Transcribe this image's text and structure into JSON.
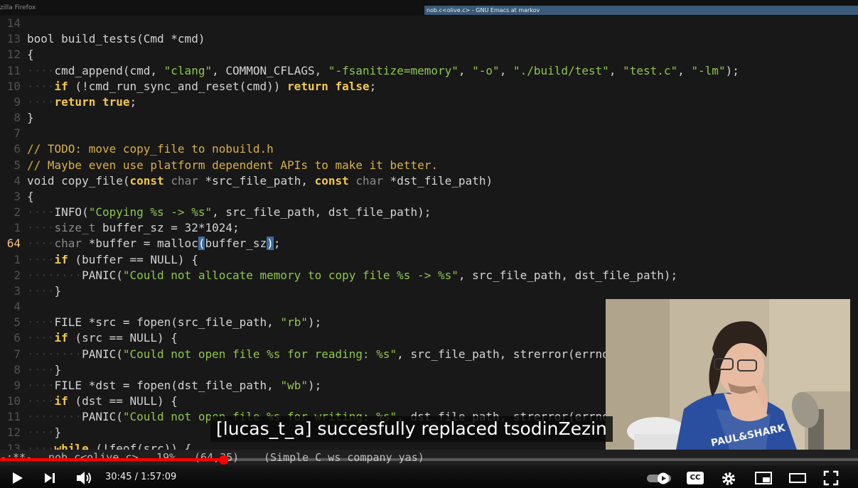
{
  "browser": {
    "title_fragment": "zilla Firefox"
  },
  "emacs": {
    "window_title": "nob.c<olive.c> - GNU Emacs at markov"
  },
  "colors": {
    "keyword": "#f2c94c",
    "string": "#8fc54e",
    "comment": "#d8b04a",
    "type": "#8a8a8a",
    "cursor": "#3d6d9d",
    "progress": "#ff0000"
  },
  "code": [
    {
      "ln": "14",
      "segs": []
    },
    {
      "ln": "13",
      "segs": [
        [
          "p",
          "bool build_tests(Cmd *cmd)"
        ]
      ]
    },
    {
      "ln": "12",
      "segs": [
        [
          "p",
          "{"
        ]
      ]
    },
    {
      "ln": "11",
      "segs": [
        [
          "i",
          "····"
        ],
        [
          "p",
          "cmd_append(cmd, "
        ],
        [
          "s",
          "\"clang\""
        ],
        [
          "p",
          ", COMMON_CFLAGS, "
        ],
        [
          "s",
          "\"-fsanitize=memory\""
        ],
        [
          "p",
          ", "
        ],
        [
          "s",
          "\"-o\""
        ],
        [
          "p",
          ", "
        ],
        [
          "s",
          "\"./build/test\""
        ],
        [
          "p",
          ", "
        ],
        [
          "s",
          "\"test.c\""
        ],
        [
          "p",
          ", "
        ],
        [
          "s",
          "\"-lm\""
        ],
        [
          "p",
          ");"
        ]
      ]
    },
    {
      "ln": "10",
      "segs": [
        [
          "i",
          "····"
        ],
        [
          "k",
          "if"
        ],
        [
          "p",
          " (!cmd_run_sync_and_reset(cmd)) "
        ],
        [
          "k",
          "return"
        ],
        [
          "p",
          " "
        ],
        [
          "k",
          "false"
        ],
        [
          "p",
          ";"
        ]
      ]
    },
    {
      "ln": "9",
      "segs": [
        [
          "i",
          "····"
        ],
        [
          "k",
          "return"
        ],
        [
          "p",
          " "
        ],
        [
          "k",
          "true"
        ],
        [
          "p",
          ";"
        ]
      ]
    },
    {
      "ln": "8",
      "segs": [
        [
          "p",
          "}"
        ]
      ]
    },
    {
      "ln": "7",
      "segs": []
    },
    {
      "ln": "6",
      "segs": [
        [
          "c",
          "// TODO: move copy_file to nobuild.h"
        ]
      ]
    },
    {
      "ln": "5",
      "segs": [
        [
          "c",
          "// Maybe even use platform dependent APIs to make it better."
        ]
      ]
    },
    {
      "ln": "4",
      "segs": [
        [
          "p",
          "void copy_file("
        ],
        [
          "k",
          "const"
        ],
        [
          "p",
          " "
        ],
        [
          "t",
          "char"
        ],
        [
          "p",
          " *src_file_path, "
        ],
        [
          "k",
          "const"
        ],
        [
          "p",
          " "
        ],
        [
          "t",
          "char"
        ],
        [
          "p",
          " *dst_file_path)"
        ]
      ]
    },
    {
      "ln": "3",
      "segs": [
        [
          "p",
          "{"
        ]
      ]
    },
    {
      "ln": "2",
      "segs": [
        [
          "i",
          "····"
        ],
        [
          "p",
          "INFO("
        ],
        [
          "s",
          "\"Copying %s -> %s\""
        ],
        [
          "p",
          ", src_file_path, dst_file_path);"
        ]
      ]
    },
    {
      "ln": "1",
      "segs": [
        [
          "i",
          "····"
        ],
        [
          "t",
          "size_t"
        ],
        [
          "p",
          " buffer_sz = 32*1024;"
        ]
      ]
    },
    {
      "ln": "64",
      "cur": true,
      "segs": [
        [
          "i",
          "····"
        ],
        [
          "t",
          "char"
        ],
        [
          "p",
          " *buffer = malloc"
        ],
        [
          "x",
          "("
        ],
        [
          "p",
          "buffer_sz"
        ],
        [
          "x",
          ")"
        ],
        [
          "p",
          ";"
        ]
      ]
    },
    {
      "ln": "1",
      "segs": [
        [
          "i",
          "····"
        ],
        [
          "k",
          "if"
        ],
        [
          "p",
          " (buffer == NULL) {"
        ]
      ]
    },
    {
      "ln": "2",
      "segs": [
        [
          "i",
          "········"
        ],
        [
          "p",
          "PANIC("
        ],
        [
          "s",
          "\"Could not allocate memory to copy file %s -> %s\""
        ],
        [
          "p",
          ", src_file_path, dst_file_path);"
        ]
      ]
    },
    {
      "ln": "3",
      "segs": [
        [
          "i",
          "····"
        ],
        [
          "p",
          "}"
        ]
      ]
    },
    {
      "ln": "4",
      "segs": []
    },
    {
      "ln": "5",
      "segs": [
        [
          "i",
          "····"
        ],
        [
          "p",
          "FILE *src = fopen(src_file_path, "
        ],
        [
          "s",
          "\"rb\""
        ],
        [
          "p",
          ");"
        ]
      ]
    },
    {
      "ln": "6",
      "segs": [
        [
          "i",
          "····"
        ],
        [
          "k",
          "if"
        ],
        [
          "p",
          " (src == NULL) {"
        ]
      ]
    },
    {
      "ln": "7",
      "segs": [
        [
          "i",
          "········"
        ],
        [
          "p",
          "PANIC("
        ],
        [
          "s",
          "\"Could not open file %s for reading: %s\""
        ],
        [
          "p",
          ", src_file_path, strerror(errno));"
        ]
      ]
    },
    {
      "ln": "8",
      "segs": [
        [
          "i",
          "····"
        ],
        [
          "p",
          "}"
        ]
      ]
    },
    {
      "ln": "9",
      "segs": [
        [
          "i",
          "····"
        ],
        [
          "p",
          "FILE *dst = fopen(dst_file_path, "
        ],
        [
          "s",
          "\"wb\""
        ],
        [
          "p",
          ");"
        ]
      ]
    },
    {
      "ln": "10",
      "segs": [
        [
          "i",
          "····"
        ],
        [
          "k",
          "if"
        ],
        [
          "p",
          " (dst == NULL) {"
        ]
      ]
    },
    {
      "ln": "11",
      "segs": [
        [
          "i",
          "········"
        ],
        [
          "p",
          "PANIC("
        ],
        [
          "s",
          "\"Could not open file %s for writing: %s\""
        ],
        [
          "p",
          ", dst_file_path, strerror(errno));"
        ]
      ]
    },
    {
      "ln": "12",
      "segs": [
        [
          "i",
          "····"
        ],
        [
          "p",
          "}"
        ]
      ]
    },
    {
      "ln": "13",
      "segs": [
        [
          "i",
          "····"
        ],
        [
          "k",
          "while"
        ],
        [
          "p",
          " (!feof(src)) {"
        ]
      ]
    }
  ],
  "modeline": {
    "state": "-:**-",
    "buffer": "nob.c<olive.c>",
    "percent": "19%",
    "position": "(64,35)",
    "modes": "(Simple C ws company yas)"
  },
  "player": {
    "current_time": "30:45",
    "separator": " / ",
    "duration": "1:57:09",
    "progress": 0.26,
    "caption": "[lucas_t_a] succesfully replaced tsodinZezin",
    "cc_label": "CC"
  }
}
